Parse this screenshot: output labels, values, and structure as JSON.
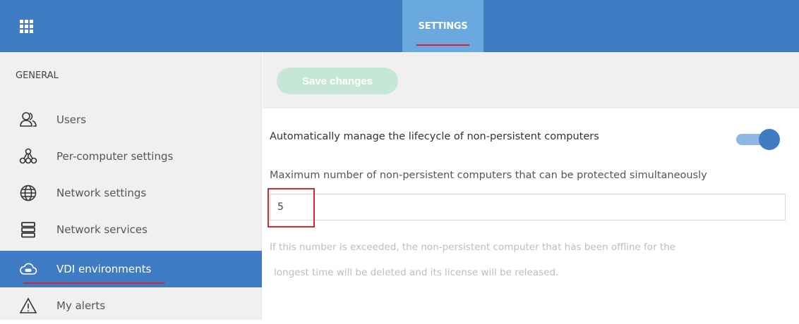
{
  "topbar": {
    "apps_icon": "apps-grid-icon",
    "tab_label": "SETTINGS"
  },
  "sidebar": {
    "heading": "GENERAL",
    "items": [
      {
        "label": "Users",
        "icon": "users-icon"
      },
      {
        "label": "Per-computer settings",
        "icon": "per-computer-settings-icon"
      },
      {
        "label": "Network settings",
        "icon": "globe-icon"
      },
      {
        "label": "Network services",
        "icon": "server-icon"
      },
      {
        "label": "VDI environments",
        "icon": "vdi-cloud-icon",
        "active": true
      },
      {
        "label": "My alerts",
        "icon": "warning-icon"
      }
    ]
  },
  "toolbar": {
    "save_label": "Save changes"
  },
  "content": {
    "auto_manage_label": "Automatically manage the lifecycle of non-persistent computers",
    "auto_manage_enabled": true,
    "max_label": "Maximum number of non-persistent computers that can be protected simultaneously",
    "max_value": "5",
    "help_line1": "If this number is exceeded, the non-persistent computer that has been offline for the",
    "help_line2": "longest time will be deleted and its license will be released."
  },
  "colors": {
    "accent": "#3f7cc4",
    "tab_active": "#6aa9e0",
    "highlight_red": "#e0252f",
    "save_disabled": "#c5e8d6"
  }
}
